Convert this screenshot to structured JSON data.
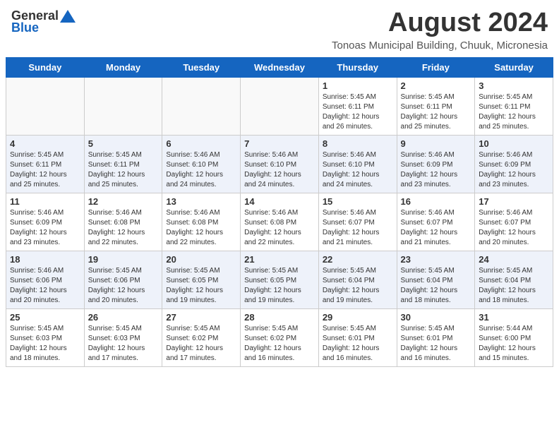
{
  "header": {
    "logo_general": "General",
    "logo_blue": "Blue",
    "main_title": "August 2024",
    "subtitle": "Tonoas Municipal Building, Chuuk, Micronesia"
  },
  "calendar": {
    "days_of_week": [
      "Sunday",
      "Monday",
      "Tuesday",
      "Wednesday",
      "Thursday",
      "Friday",
      "Saturday"
    ],
    "weeks": [
      [
        {
          "day": "",
          "info": ""
        },
        {
          "day": "",
          "info": ""
        },
        {
          "day": "",
          "info": ""
        },
        {
          "day": "",
          "info": ""
        },
        {
          "day": "1",
          "info": "Sunrise: 5:45 AM\nSunset: 6:11 PM\nDaylight: 12 hours\nand 26 minutes."
        },
        {
          "day": "2",
          "info": "Sunrise: 5:45 AM\nSunset: 6:11 PM\nDaylight: 12 hours\nand 25 minutes."
        },
        {
          "day": "3",
          "info": "Sunrise: 5:45 AM\nSunset: 6:11 PM\nDaylight: 12 hours\nand 25 minutes."
        }
      ],
      [
        {
          "day": "4",
          "info": "Sunrise: 5:45 AM\nSunset: 6:11 PM\nDaylight: 12 hours\nand 25 minutes."
        },
        {
          "day": "5",
          "info": "Sunrise: 5:45 AM\nSunset: 6:11 PM\nDaylight: 12 hours\nand 25 minutes."
        },
        {
          "day": "6",
          "info": "Sunrise: 5:46 AM\nSunset: 6:10 PM\nDaylight: 12 hours\nand 24 minutes."
        },
        {
          "day": "7",
          "info": "Sunrise: 5:46 AM\nSunset: 6:10 PM\nDaylight: 12 hours\nand 24 minutes."
        },
        {
          "day": "8",
          "info": "Sunrise: 5:46 AM\nSunset: 6:10 PM\nDaylight: 12 hours\nand 24 minutes."
        },
        {
          "day": "9",
          "info": "Sunrise: 5:46 AM\nSunset: 6:09 PM\nDaylight: 12 hours\nand 23 minutes."
        },
        {
          "day": "10",
          "info": "Sunrise: 5:46 AM\nSunset: 6:09 PM\nDaylight: 12 hours\nand 23 minutes."
        }
      ],
      [
        {
          "day": "11",
          "info": "Sunrise: 5:46 AM\nSunset: 6:09 PM\nDaylight: 12 hours\nand 23 minutes."
        },
        {
          "day": "12",
          "info": "Sunrise: 5:46 AM\nSunset: 6:08 PM\nDaylight: 12 hours\nand 22 minutes."
        },
        {
          "day": "13",
          "info": "Sunrise: 5:46 AM\nSunset: 6:08 PM\nDaylight: 12 hours\nand 22 minutes."
        },
        {
          "day": "14",
          "info": "Sunrise: 5:46 AM\nSunset: 6:08 PM\nDaylight: 12 hours\nand 22 minutes."
        },
        {
          "day": "15",
          "info": "Sunrise: 5:46 AM\nSunset: 6:07 PM\nDaylight: 12 hours\nand 21 minutes."
        },
        {
          "day": "16",
          "info": "Sunrise: 5:46 AM\nSunset: 6:07 PM\nDaylight: 12 hours\nand 21 minutes."
        },
        {
          "day": "17",
          "info": "Sunrise: 5:46 AM\nSunset: 6:07 PM\nDaylight: 12 hours\nand 20 minutes."
        }
      ],
      [
        {
          "day": "18",
          "info": "Sunrise: 5:46 AM\nSunset: 6:06 PM\nDaylight: 12 hours\nand 20 minutes."
        },
        {
          "day": "19",
          "info": "Sunrise: 5:45 AM\nSunset: 6:06 PM\nDaylight: 12 hours\nand 20 minutes."
        },
        {
          "day": "20",
          "info": "Sunrise: 5:45 AM\nSunset: 6:05 PM\nDaylight: 12 hours\nand 19 minutes."
        },
        {
          "day": "21",
          "info": "Sunrise: 5:45 AM\nSunset: 6:05 PM\nDaylight: 12 hours\nand 19 minutes."
        },
        {
          "day": "22",
          "info": "Sunrise: 5:45 AM\nSunset: 6:04 PM\nDaylight: 12 hours\nand 19 minutes."
        },
        {
          "day": "23",
          "info": "Sunrise: 5:45 AM\nSunset: 6:04 PM\nDaylight: 12 hours\nand 18 minutes."
        },
        {
          "day": "24",
          "info": "Sunrise: 5:45 AM\nSunset: 6:04 PM\nDaylight: 12 hours\nand 18 minutes."
        }
      ],
      [
        {
          "day": "25",
          "info": "Sunrise: 5:45 AM\nSunset: 6:03 PM\nDaylight: 12 hours\nand 18 minutes."
        },
        {
          "day": "26",
          "info": "Sunrise: 5:45 AM\nSunset: 6:03 PM\nDaylight: 12 hours\nand 17 minutes."
        },
        {
          "day": "27",
          "info": "Sunrise: 5:45 AM\nSunset: 6:02 PM\nDaylight: 12 hours\nand 17 minutes."
        },
        {
          "day": "28",
          "info": "Sunrise: 5:45 AM\nSunset: 6:02 PM\nDaylight: 12 hours\nand 16 minutes."
        },
        {
          "day": "29",
          "info": "Sunrise: 5:45 AM\nSunset: 6:01 PM\nDaylight: 12 hours\nand 16 minutes."
        },
        {
          "day": "30",
          "info": "Sunrise: 5:45 AM\nSunset: 6:01 PM\nDaylight: 12 hours\nand 16 minutes."
        },
        {
          "day": "31",
          "info": "Sunrise: 5:44 AM\nSunset: 6:00 PM\nDaylight: 12 hours\nand 15 minutes."
        }
      ]
    ]
  }
}
